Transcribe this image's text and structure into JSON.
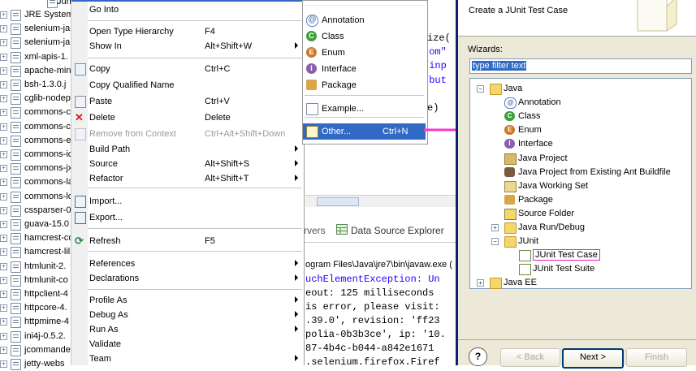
{
  "explorer": {
    "top_item": "Jun",
    "items": [
      "JRE System",
      "selenium-ja",
      "selenium-ja",
      "xml-apis-1.",
      "apache-min",
      "bsh-1.3.0.j",
      "cglib-nodep",
      "commons-c",
      "commons-c",
      "commons-e",
      "commons-ic",
      "commons-jx",
      "commons-la",
      "commons-lo",
      "cssparser-0",
      "guava-15.0",
      "hamcrest-co",
      "hamcrest-lil",
      "htmlunit-2.",
      "htmlunit-co",
      "httpclient-4",
      "httpcore-4.",
      "httpmime-4",
      "ini4j-0.5.2.",
      "jcommande",
      "jetty-webs"
    ]
  },
  "editor": {
    "lines": [
      "ize(",
      "com\"",
      "/inp",
      "/but",
      "e)"
    ]
  },
  "context_menu": {
    "items": [
      {
        "label": "Go Into",
        "key": ""
      },
      {
        "label": "Open Type Hierarchy",
        "key": "F4"
      },
      {
        "label": "Show In",
        "key": "Alt+Shift+W"
      },
      {
        "label": "Copy",
        "key": "Ctrl+C"
      },
      {
        "label": "Copy Qualified Name",
        "key": ""
      },
      {
        "label": "Paste",
        "key": "Ctrl+V"
      },
      {
        "label": "Delete",
        "key": "Delete"
      },
      {
        "label": "Remove from Context",
        "key": "Ctrl+Alt+Shift+Down"
      },
      {
        "label": "Build Path",
        "key": ""
      },
      {
        "label": "Source",
        "key": "Alt+Shift+S"
      },
      {
        "label": "Refactor",
        "key": "Alt+Shift+T"
      },
      {
        "label": "Import...",
        "key": ""
      },
      {
        "label": "Export...",
        "key": ""
      },
      {
        "label": "Refresh",
        "key": "F5"
      },
      {
        "label": "References",
        "key": ""
      },
      {
        "label": "Declarations",
        "key": ""
      },
      {
        "label": "Profile As",
        "key": ""
      },
      {
        "label": "Debug As",
        "key": ""
      },
      {
        "label": "Run As",
        "key": ""
      },
      {
        "label": "Validate",
        "key": ""
      },
      {
        "label": "Team",
        "key": ""
      }
    ]
  },
  "new_submenu": {
    "items": [
      {
        "label": "Annotation",
        "key": ""
      },
      {
        "label": "Class",
        "key": ""
      },
      {
        "label": "Enum",
        "key": ""
      },
      {
        "label": "Interface",
        "key": ""
      },
      {
        "label": "Package",
        "key": ""
      },
      {
        "label": "Example...",
        "key": ""
      },
      {
        "label": "Other...",
        "key": "Ctrl+N"
      }
    ]
  },
  "bottom_tabs": {
    "servers": "rvers",
    "data_source": "Data Source Explorer"
  },
  "console": {
    "lines": [
      "ogram Files\\Java\\jre7\\bin\\javaw.exe (",
      "uchElementException: Un",
      "eout: 125 milliseconds",
      "is error, please visit:",
      ".39.0', revision: 'ff23",
      "polia-0b3b3ce', ip: '10.",
      "87-4b4c-b044-a842e1671",
      ".selenium.firefox.Firef"
    ]
  },
  "wizard": {
    "header_title": "Create a JUnit Test Case",
    "wizards_label": "Wizards:",
    "filter_value": "type filter text",
    "tree": [
      {
        "label": "Java",
        "level": 0,
        "expander": "-",
        "icon": "folder"
      },
      {
        "label": "Annotation",
        "level": 1,
        "icon": "annotation-icon"
      },
      {
        "label": "Class",
        "level": 1,
        "icon": "class-icon"
      },
      {
        "label": "Enum",
        "level": 1,
        "icon": "enum-icon"
      },
      {
        "label": "Interface",
        "level": 1,
        "icon": "interface-icon"
      },
      {
        "label": "Java Project",
        "level": 1,
        "icon": "java-project-icon"
      },
      {
        "label": "Java Project from Existing Ant Buildfile",
        "level": 1,
        "icon": "ant-project-icon"
      },
      {
        "label": "Java Working Set",
        "level": 1,
        "icon": "working-set-icon"
      },
      {
        "label": "Package",
        "level": 1,
        "icon": "package-icon"
      },
      {
        "label": "Source Folder",
        "level": 1,
        "icon": "source-folder-icon"
      },
      {
        "label": "Java Run/Debug",
        "level": 1,
        "expander": "+",
        "icon": "folder"
      },
      {
        "label": "JUnit",
        "level": 1,
        "expander": "-",
        "icon": "folder"
      },
      {
        "label": "JUnit Test Case",
        "level": 2,
        "icon": "junit-test-case-icon",
        "selected": true
      },
      {
        "label": "JUnit Test Suite",
        "level": 2,
        "icon": "junit-test-suite-icon"
      },
      {
        "label": "Java EE",
        "level": 0,
        "expander": "+",
        "icon": "folder"
      }
    ],
    "buttons": {
      "help": "?",
      "back": "< Back",
      "next": "Next >",
      "finish": "Finish"
    }
  },
  "colors": {
    "menu_selection": "#316ac5",
    "annotation_arrow": "#ff33cc",
    "dialog_border": "#0a246a"
  }
}
